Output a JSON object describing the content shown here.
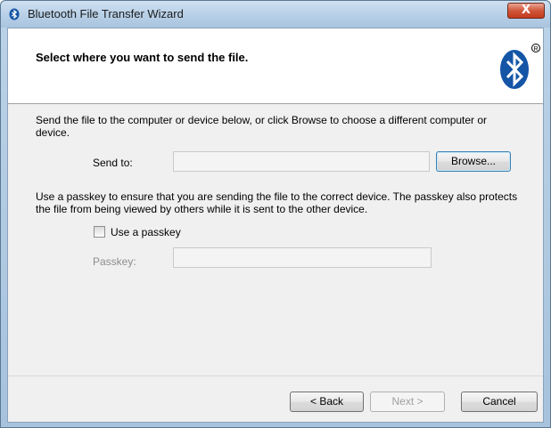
{
  "window": {
    "title": "Bluetooth File Transfer Wizard",
    "close_label": "X"
  },
  "header": {
    "title": "Select where you want to send the file."
  },
  "send": {
    "description": "Send the file to the computer or device below, or click Browse to choose a different computer or device.",
    "label": "Send to:",
    "value": "",
    "browse_label": "Browse..."
  },
  "passkey": {
    "description": "Use a passkey to ensure that you are sending the file to the correct device. The passkey also protects the file from being viewed by others while it is sent to the other device.",
    "checkbox_label": "Use a passkey",
    "checked": false,
    "label": "Passkey:",
    "value": ""
  },
  "footer": {
    "back_label": "< Back",
    "next_label": "Next >",
    "cancel_label": "Cancel"
  },
  "colors": {
    "bluetooth_blue": "#1455a6",
    "close_red": "#c23a1d"
  }
}
